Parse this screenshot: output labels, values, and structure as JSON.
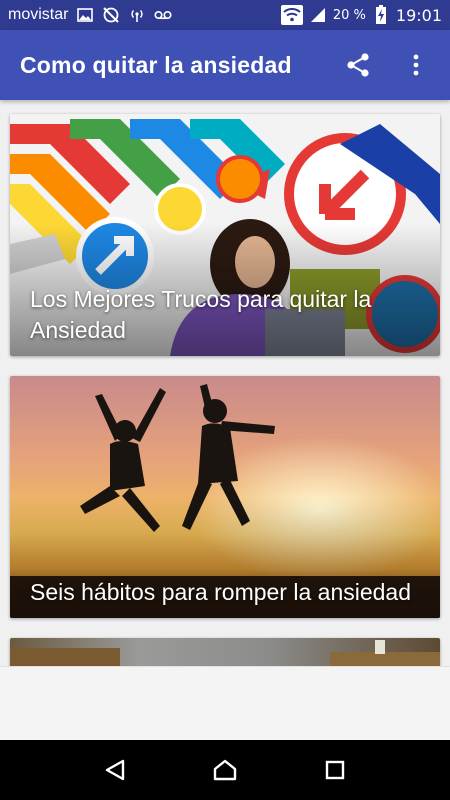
{
  "status_bar": {
    "carrier": "movistar",
    "battery_percent": "20 %",
    "time": "19:01",
    "icons": [
      "image-icon",
      "sync-off-icon",
      "hotspot-icon",
      "voicemail-icon",
      "wifi-icon",
      "signal-icon",
      "battery-charging-icon"
    ]
  },
  "app_bar": {
    "title": "Como quitar la ansiedad",
    "actions": [
      "share-icon",
      "overflow-menu-icon"
    ]
  },
  "articles": [
    {
      "title": "Los Mejores Trucos para quitar la Ansiedad"
    },
    {
      "title": "Seis hábitos para romper la ansiedad"
    },
    {
      "title": ""
    }
  ],
  "nav_bar": {
    "buttons": [
      "back-icon",
      "home-icon",
      "recents-icon"
    ]
  },
  "colors": {
    "status_bar": "#2f3a91",
    "app_bar": "#3f51b5",
    "background": "#f0f0f0"
  }
}
